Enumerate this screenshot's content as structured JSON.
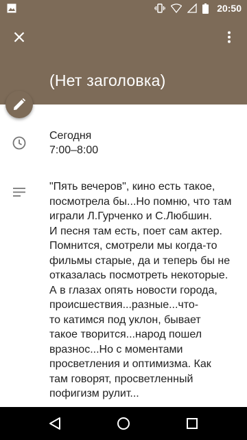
{
  "status_bar": {
    "time": "20:50",
    "icons": [
      "image-icon",
      "vibrate-icon",
      "wifi-icon",
      "signal-icon",
      "battery-icon"
    ]
  },
  "header": {
    "title": "(Нет заголовка)",
    "background_color": "#7d6b58",
    "close_icon": "close-icon",
    "more_icon": "more-vert-icon"
  },
  "fab": {
    "icon": "edit-pencil-icon"
  },
  "event": {
    "date_label": "Сегодня",
    "time_range": "7:00–8:00",
    "description": "\"Пять вечеров\", кино есть такое,\nпосмотрела бы...Но помню, что там\nиграли Л.Гурченко и С.Любшин.\nИ песня там есть, поет сам актер.\nПомнится,  смотрели мы когда-то\nфильмы старые, да и теперь бы не\nотказалась посмотреть некоторые.\nА в глазах опять новости города,\nпроисшествия...разные...что-\nто катимся под уклон, бывает\nтакое творится...народ пошел\nвразнос...Но с моментами\nпросветления и оптимизма. Как\nтам говорят, просветленный\nпофигизм рулит..."
  },
  "nav_bar": {
    "back_icon": "back-icon",
    "home_icon": "home-icon",
    "recents_icon": "recents-icon"
  }
}
